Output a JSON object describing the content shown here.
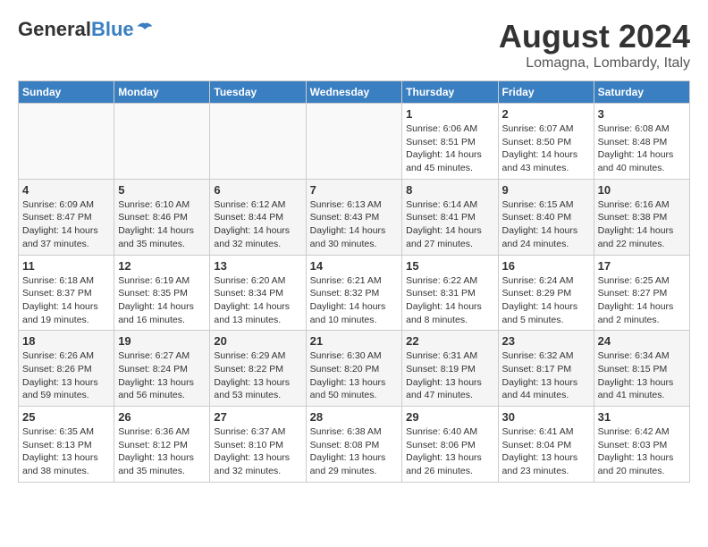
{
  "logo": {
    "general": "General",
    "blue": "Blue"
  },
  "title": "August 2024",
  "location": "Lomagna, Lombardy, Italy",
  "weekdays": [
    "Sunday",
    "Monday",
    "Tuesday",
    "Wednesday",
    "Thursday",
    "Friday",
    "Saturday"
  ],
  "weeks": [
    [
      {
        "day": "",
        "info": ""
      },
      {
        "day": "",
        "info": ""
      },
      {
        "day": "",
        "info": ""
      },
      {
        "day": "",
        "info": ""
      },
      {
        "day": "1",
        "info": "Sunrise: 6:06 AM\nSunset: 8:51 PM\nDaylight: 14 hours\nand 45 minutes."
      },
      {
        "day": "2",
        "info": "Sunrise: 6:07 AM\nSunset: 8:50 PM\nDaylight: 14 hours\nand 43 minutes."
      },
      {
        "day": "3",
        "info": "Sunrise: 6:08 AM\nSunset: 8:48 PM\nDaylight: 14 hours\nand 40 minutes."
      }
    ],
    [
      {
        "day": "4",
        "info": "Sunrise: 6:09 AM\nSunset: 8:47 PM\nDaylight: 14 hours\nand 37 minutes."
      },
      {
        "day": "5",
        "info": "Sunrise: 6:10 AM\nSunset: 8:46 PM\nDaylight: 14 hours\nand 35 minutes."
      },
      {
        "day": "6",
        "info": "Sunrise: 6:12 AM\nSunset: 8:44 PM\nDaylight: 14 hours\nand 32 minutes."
      },
      {
        "day": "7",
        "info": "Sunrise: 6:13 AM\nSunset: 8:43 PM\nDaylight: 14 hours\nand 30 minutes."
      },
      {
        "day": "8",
        "info": "Sunrise: 6:14 AM\nSunset: 8:41 PM\nDaylight: 14 hours\nand 27 minutes."
      },
      {
        "day": "9",
        "info": "Sunrise: 6:15 AM\nSunset: 8:40 PM\nDaylight: 14 hours\nand 24 minutes."
      },
      {
        "day": "10",
        "info": "Sunrise: 6:16 AM\nSunset: 8:38 PM\nDaylight: 14 hours\nand 22 minutes."
      }
    ],
    [
      {
        "day": "11",
        "info": "Sunrise: 6:18 AM\nSunset: 8:37 PM\nDaylight: 14 hours\nand 19 minutes."
      },
      {
        "day": "12",
        "info": "Sunrise: 6:19 AM\nSunset: 8:35 PM\nDaylight: 14 hours\nand 16 minutes."
      },
      {
        "day": "13",
        "info": "Sunrise: 6:20 AM\nSunset: 8:34 PM\nDaylight: 14 hours\nand 13 minutes."
      },
      {
        "day": "14",
        "info": "Sunrise: 6:21 AM\nSunset: 8:32 PM\nDaylight: 14 hours\nand 10 minutes."
      },
      {
        "day": "15",
        "info": "Sunrise: 6:22 AM\nSunset: 8:31 PM\nDaylight: 14 hours\nand 8 minutes."
      },
      {
        "day": "16",
        "info": "Sunrise: 6:24 AM\nSunset: 8:29 PM\nDaylight: 14 hours\nand 5 minutes."
      },
      {
        "day": "17",
        "info": "Sunrise: 6:25 AM\nSunset: 8:27 PM\nDaylight: 14 hours\nand 2 minutes."
      }
    ],
    [
      {
        "day": "18",
        "info": "Sunrise: 6:26 AM\nSunset: 8:26 PM\nDaylight: 13 hours\nand 59 minutes."
      },
      {
        "day": "19",
        "info": "Sunrise: 6:27 AM\nSunset: 8:24 PM\nDaylight: 13 hours\nand 56 minutes."
      },
      {
        "day": "20",
        "info": "Sunrise: 6:29 AM\nSunset: 8:22 PM\nDaylight: 13 hours\nand 53 minutes."
      },
      {
        "day": "21",
        "info": "Sunrise: 6:30 AM\nSunset: 8:20 PM\nDaylight: 13 hours\nand 50 minutes."
      },
      {
        "day": "22",
        "info": "Sunrise: 6:31 AM\nSunset: 8:19 PM\nDaylight: 13 hours\nand 47 minutes."
      },
      {
        "day": "23",
        "info": "Sunrise: 6:32 AM\nSunset: 8:17 PM\nDaylight: 13 hours\nand 44 minutes."
      },
      {
        "day": "24",
        "info": "Sunrise: 6:34 AM\nSunset: 8:15 PM\nDaylight: 13 hours\nand 41 minutes."
      }
    ],
    [
      {
        "day": "25",
        "info": "Sunrise: 6:35 AM\nSunset: 8:13 PM\nDaylight: 13 hours\nand 38 minutes."
      },
      {
        "day": "26",
        "info": "Sunrise: 6:36 AM\nSunset: 8:12 PM\nDaylight: 13 hours\nand 35 minutes."
      },
      {
        "day": "27",
        "info": "Sunrise: 6:37 AM\nSunset: 8:10 PM\nDaylight: 13 hours\nand 32 minutes."
      },
      {
        "day": "28",
        "info": "Sunrise: 6:38 AM\nSunset: 8:08 PM\nDaylight: 13 hours\nand 29 minutes."
      },
      {
        "day": "29",
        "info": "Sunrise: 6:40 AM\nSunset: 8:06 PM\nDaylight: 13 hours\nand 26 minutes."
      },
      {
        "day": "30",
        "info": "Sunrise: 6:41 AM\nSunset: 8:04 PM\nDaylight: 13 hours\nand 23 minutes."
      },
      {
        "day": "31",
        "info": "Sunrise: 6:42 AM\nSunset: 8:03 PM\nDaylight: 13 hours\nand 20 minutes."
      }
    ]
  ]
}
